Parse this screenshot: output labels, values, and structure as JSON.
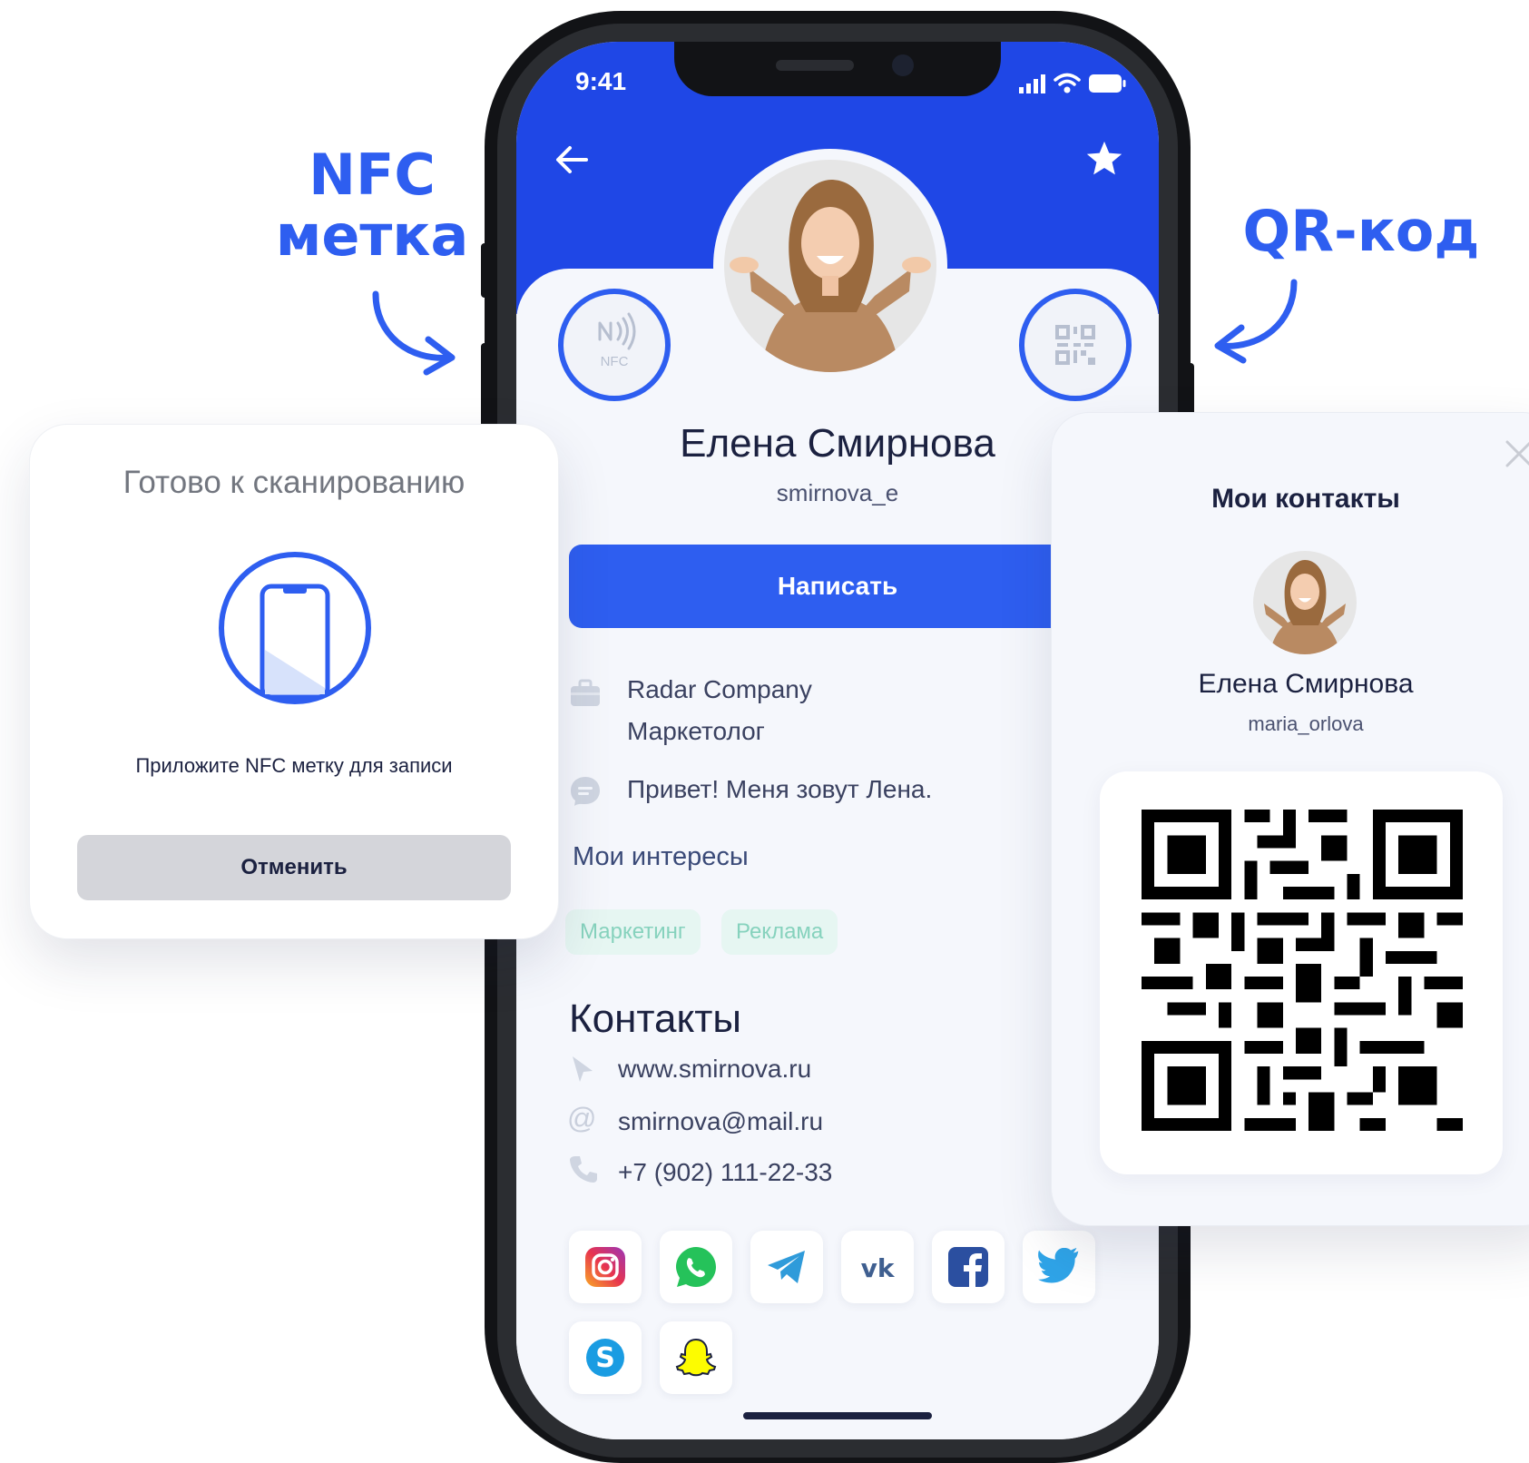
{
  "annotations": {
    "nfc_line1": "NFC",
    "nfc_line2": "метка",
    "qr_label": "QR-код"
  },
  "status_bar": {
    "time": "9:41"
  },
  "profile": {
    "name": "Елена Смирнова",
    "username": "smirnova_e",
    "write_button": "Написать",
    "nfc_badge": "NFC",
    "company": "Radar Company",
    "position": "Маркетолог",
    "bio": "Привет! Меня зовут Лена.",
    "interests_title": "Мои интересы",
    "interests": [
      "Маркетинг",
      "Реклама"
    ],
    "contacts_title": "Контакты",
    "website": "www.smirnova.ru",
    "email": "smirnova@mail.ru",
    "phone": "+7 (902) 111-22-33",
    "socials": [
      "instagram-icon",
      "whatsapp-icon",
      "telegram-icon",
      "vk-icon",
      "facebook-icon",
      "twitter-icon",
      "skype-icon",
      "snapchat-icon"
    ]
  },
  "nfc_popup": {
    "title": "Готово к сканированию",
    "instruction": "Приложите NFC метку для записи",
    "cancel": "Отменить"
  },
  "qr_popup": {
    "title": "Мои контакты",
    "name": "Елена Смирнова",
    "username": "maria_orlova"
  },
  "colors": {
    "accent": "#2e5ef0",
    "header": "#1f47e6",
    "tag_bg": "#e6f6f2",
    "tag_text": "#86d2bd"
  }
}
